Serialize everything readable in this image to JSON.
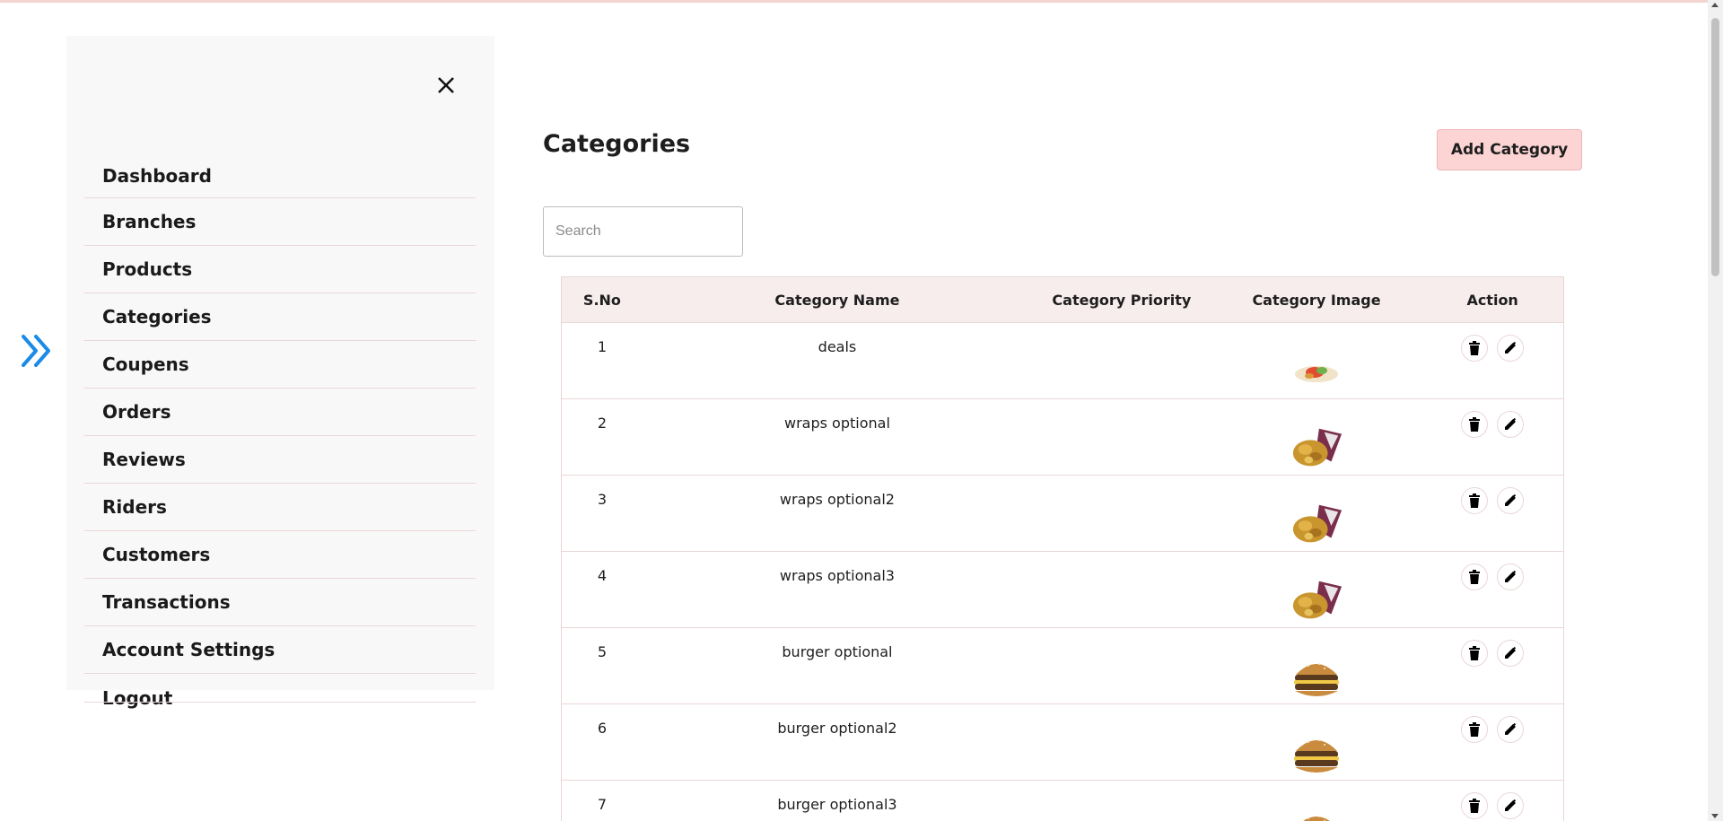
{
  "sidebar": {
    "items": [
      {
        "label": "Dashboard"
      },
      {
        "label": "Branches"
      },
      {
        "label": "Products"
      },
      {
        "label": "Categories"
      },
      {
        "label": "Coupens"
      },
      {
        "label": "Orders"
      },
      {
        "label": "Reviews"
      },
      {
        "label": "Riders"
      },
      {
        "label": "Customers"
      },
      {
        "label": "Transactions"
      },
      {
        "label": "Account Settings"
      },
      {
        "label": "Logout"
      }
    ]
  },
  "main": {
    "title": "Categories",
    "add_button": "Add Category",
    "search": {
      "placeholder": "Search",
      "value": ""
    }
  },
  "table": {
    "headers": {
      "sno": "S.No",
      "name": "Category Name",
      "priority": "Category Priority",
      "image": "Category Image",
      "action": "Action"
    },
    "rows": [
      {
        "sno": "1",
        "name": "deals",
        "priority": "",
        "image": "wrap-small"
      },
      {
        "sno": "2",
        "name": "wraps optional",
        "priority": "",
        "image": "wrap"
      },
      {
        "sno": "3",
        "name": "wraps optional2",
        "priority": "",
        "image": "wrap"
      },
      {
        "sno": "4",
        "name": "wraps optional3",
        "priority": "",
        "image": "wrap"
      },
      {
        "sno": "5",
        "name": "burger optional",
        "priority": "",
        "image": "burger"
      },
      {
        "sno": "6",
        "name": "burger optional2",
        "priority": "",
        "image": "burger"
      },
      {
        "sno": "7",
        "name": "burger optional3",
        "priority": "",
        "image": "burger"
      }
    ]
  },
  "colors": {
    "accent_blue": "#1a8be8",
    "add_button_bg": "#fcd4d4",
    "header_bg": "#f7eded",
    "sidebar_bg": "#f8f8f8",
    "border": "#ead6d6"
  },
  "icons": {
    "expand": "double-chevron-right-icon",
    "close": "close-icon",
    "delete": "trash-icon",
    "edit": "pencil-icon"
  }
}
